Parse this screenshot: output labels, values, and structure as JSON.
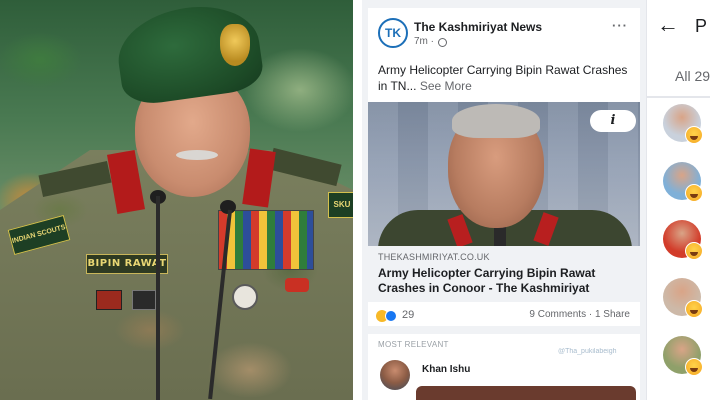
{
  "photo": {
    "nametag": "BIPIN RAWAT",
    "scout_patch": "INDIAN SCOUTS",
    "skill_patch": "SKU"
  },
  "post": {
    "page_name": "The Kashmiriyat News",
    "page_avatar_letters": "TK",
    "time": "7m ·",
    "text": "Army Helicopter Carrying Bipin Rawat Crashes in TN...",
    "see_more": "See More",
    "info_label": "i",
    "link": {
      "domain": "THEKASHMIRIYAT.CO.UK",
      "title": "Army Helicopter Carrying Bipin Rawat Crashes in Conoor - The Kashmiriyat"
    },
    "reactions_count": "29",
    "comments_share": "9 Comments · 1 Share",
    "comment_strip": "MOST RELEVANT",
    "watermark": "@Tha_pukilabeigh",
    "commenter_name": "Khan Ishu"
  },
  "panel": {
    "letter": "P",
    "tab_label": "All 29",
    "reactors": [
      {
        "avatar_color": "#c9d1dc",
        "emoji": "haha"
      },
      {
        "avatar_color": "#7fb0d8",
        "emoji": "haha"
      },
      {
        "avatar_color": "#d23c2a",
        "emoji": "haha"
      },
      {
        "avatar_color": "#cdb9a8",
        "emoji": "haha"
      },
      {
        "avatar_color": "#8fa06a",
        "emoji": "haha"
      }
    ]
  },
  "colors": {
    "facebook_blue": "#1877f2",
    "text_primary": "#1c1e21",
    "text_secondary": "#65676b",
    "feed_background": "#f0f2f5"
  }
}
